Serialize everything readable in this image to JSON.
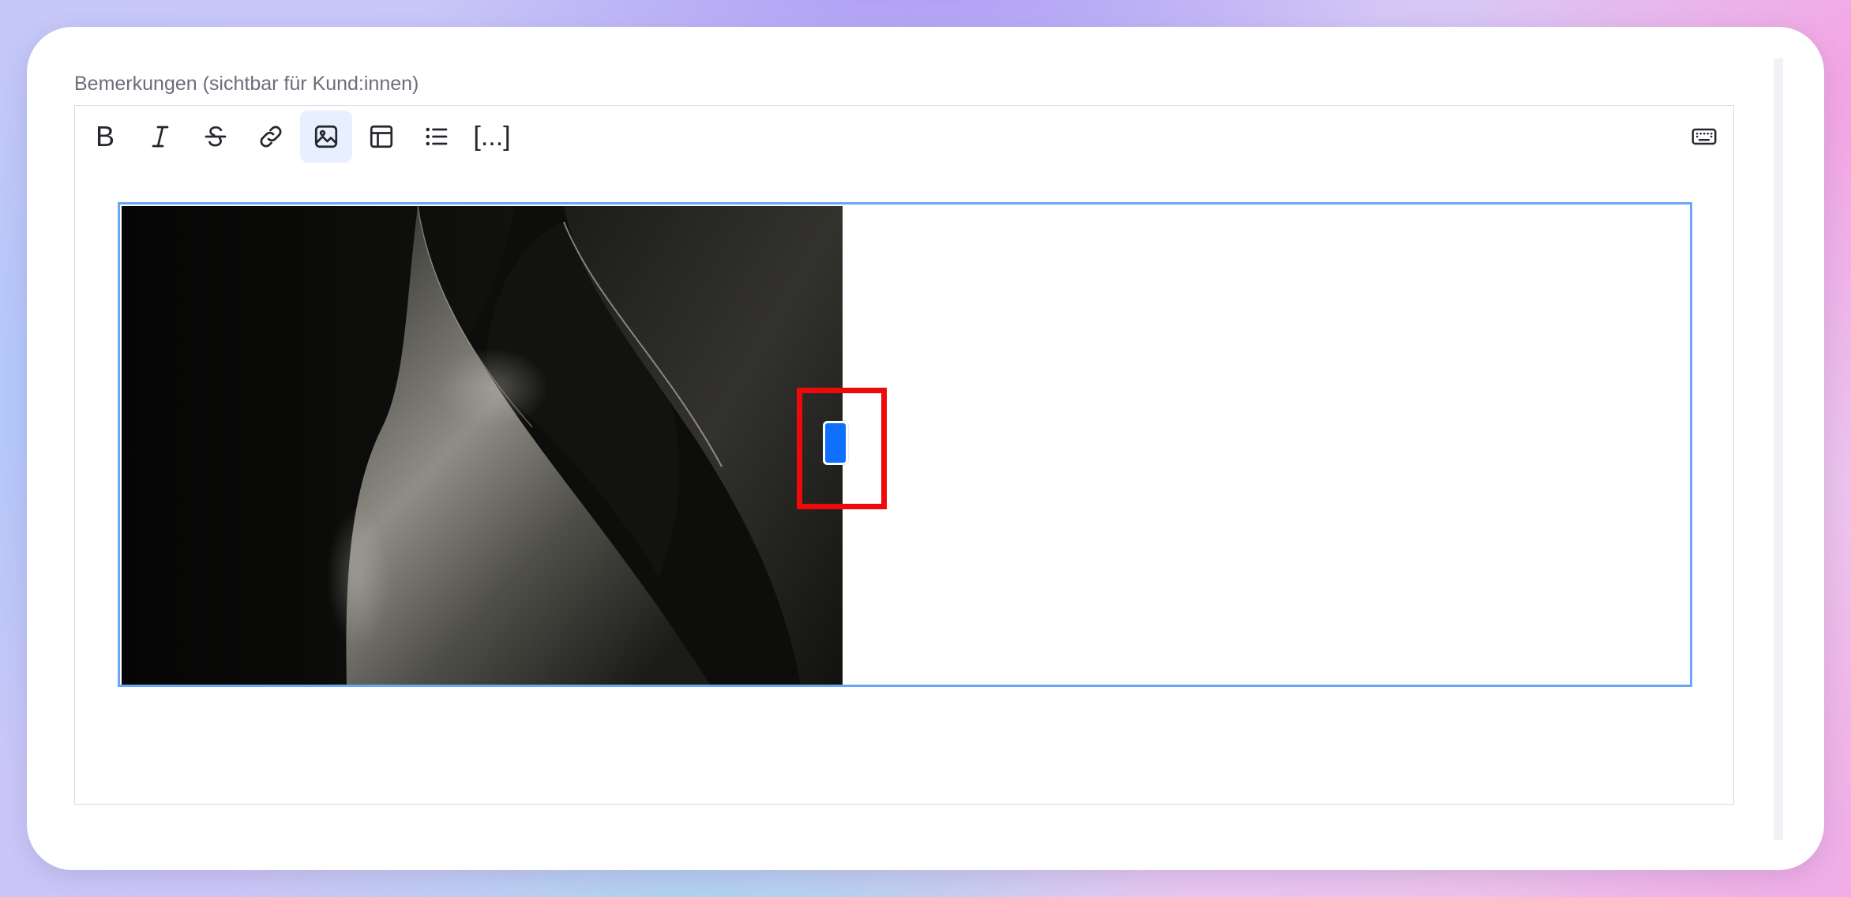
{
  "field": {
    "label": "Bemerkungen (sichtbar für Kund:innen)"
  },
  "toolbar": {
    "bold_label": "B",
    "placeholder_label": "[...]",
    "buttons": [
      {
        "name": "bold",
        "icon": "bold-icon"
      },
      {
        "name": "italic",
        "icon": "italic-icon"
      },
      {
        "name": "strikethrough",
        "icon": "strikethrough-icon"
      },
      {
        "name": "link",
        "icon": "link-icon"
      },
      {
        "name": "image",
        "icon": "image-icon",
        "active": true
      },
      {
        "name": "table",
        "icon": "table-icon"
      },
      {
        "name": "bullet-list",
        "icon": "bullet-list-icon"
      },
      {
        "name": "placeholder",
        "icon": "placeholder-icon"
      },
      {
        "name": "keyboard",
        "icon": "keyboard-icon"
      }
    ]
  },
  "colors": {
    "accent": "#0f6fff",
    "table_border": "#6aa6f3",
    "highlight": "#ee0a0a",
    "active_button_bg": "#e8f0ff",
    "label_text": "#6b6e78"
  }
}
